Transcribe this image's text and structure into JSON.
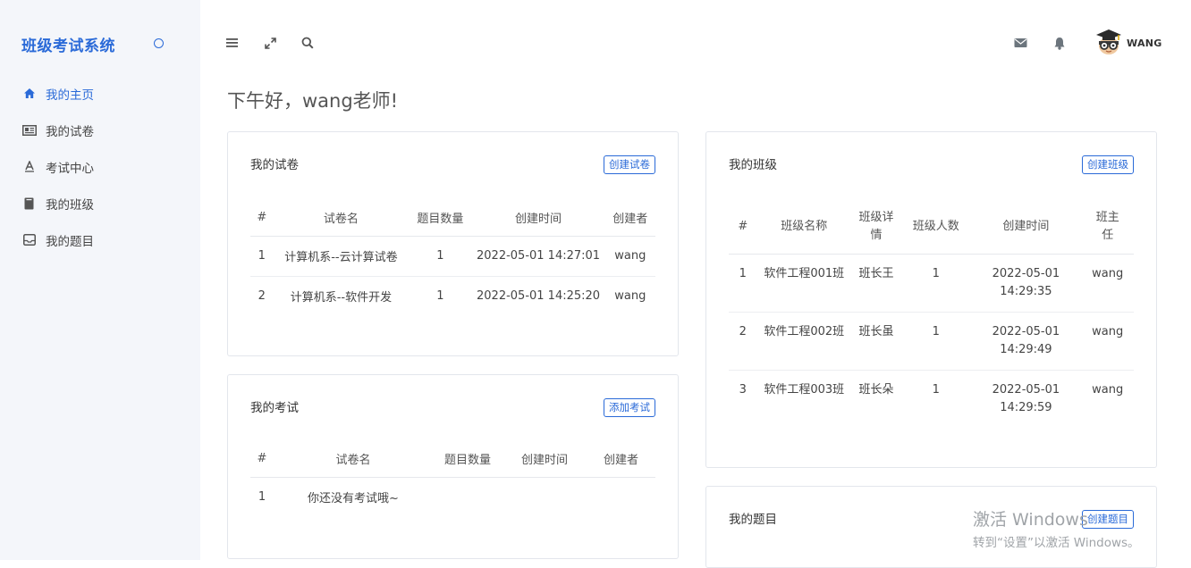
{
  "sidebar": {
    "brand": "班级考试系统",
    "items": [
      {
        "label": "我的主页",
        "icon": "home-icon"
      },
      {
        "label": "我的试卷",
        "icon": "newspaper-icon"
      },
      {
        "label": "考试中心",
        "icon": "font-icon"
      },
      {
        "label": "我的班级",
        "icon": "book-icon"
      },
      {
        "label": "我的题目",
        "icon": "inbox-icon"
      }
    ]
  },
  "topbar": {
    "icons": [
      "menu-icon",
      "expand-icon",
      "search-icon"
    ],
    "right_icons": [
      "mail-icon",
      "bell-icon"
    ],
    "user": "WANG"
  },
  "greeting": "下午好，wang老师!",
  "papers_card": {
    "title": "我的试卷",
    "button": "创建试卷",
    "headers": [
      "#",
      "试卷名",
      "题目数量",
      "创建时间",
      "创建者"
    ],
    "rows": [
      [
        "1",
        "计算机系--云计算试卷",
        "1",
        "2022-05-01 14:27:01",
        "wang"
      ],
      [
        "2",
        "计算机系--软件开发",
        "1",
        "2022-05-01 14:25:20",
        "wang"
      ]
    ]
  },
  "exams_card": {
    "title": "我的考试",
    "button": "添加考试",
    "headers": [
      "#",
      "试卷名",
      "题目数量",
      "创建时间",
      "创建者"
    ],
    "rows": [
      [
        "1",
        "你还没有考试哦~",
        "",
        "",
        ""
      ]
    ]
  },
  "classes_card": {
    "title": "我的班级",
    "button": "创建班级",
    "headers": [
      "#",
      "班级名称",
      "班级详情",
      "班级人数",
      "创建时间",
      "班主任"
    ],
    "rows": [
      [
        "1",
        "软件工程001班",
        "班长王",
        "1",
        "2022-05-01 14:29:35",
        "wang"
      ],
      [
        "2",
        "软件工程002班",
        "班长虽",
        "1",
        "2022-05-01 14:29:49",
        "wang"
      ],
      [
        "3",
        "软件工程003班",
        "班长朵",
        "1",
        "2022-05-01 14:29:59",
        "wang"
      ]
    ]
  },
  "questions_card": {
    "title": "我的题目",
    "button": "创建题目"
  },
  "watermark": {
    "line1": "激活 Windows",
    "line2": "转到“设置”以激活 Windows。"
  },
  "colors": {
    "accent": "#2a6ad8",
    "sidebar_bg": "#f4f6fa"
  }
}
